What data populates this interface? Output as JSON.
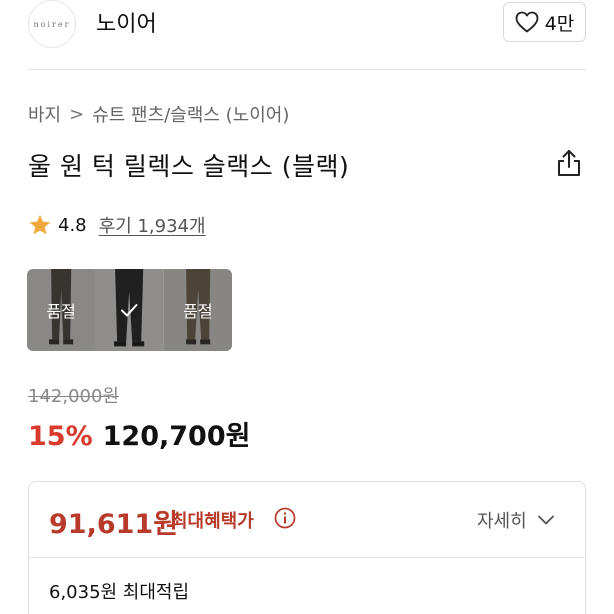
{
  "brand": {
    "logo_text": "noirer",
    "name": "노이어",
    "like_count": "4만"
  },
  "breadcrumb": {
    "items": [
      "바지",
      "슈트 팬츠/슬랙스 (노이어)"
    ],
    "separator": ">"
  },
  "product": {
    "title": "울 원 턱 릴렉스 슬랙스 (블랙)"
  },
  "rating": {
    "score": "4.8",
    "review_label": "후기 1,934개",
    "star_color": "#f0a93c"
  },
  "variants": [
    {
      "label": "품절",
      "state": "sold-out"
    },
    {
      "label": "",
      "state": "selected"
    },
    {
      "label": "품절",
      "state": "sold-out"
    }
  ],
  "price": {
    "original": "142,000원",
    "discount": "15%",
    "sale": "120,700원",
    "discount_color": "#d83b2d"
  },
  "benefit": {
    "max_price": "91,611원",
    "max_label": "최대혜택가",
    "detail_label": "자세히",
    "points": "6,035원 최대적립",
    "accent_color": "#b83a2a"
  }
}
